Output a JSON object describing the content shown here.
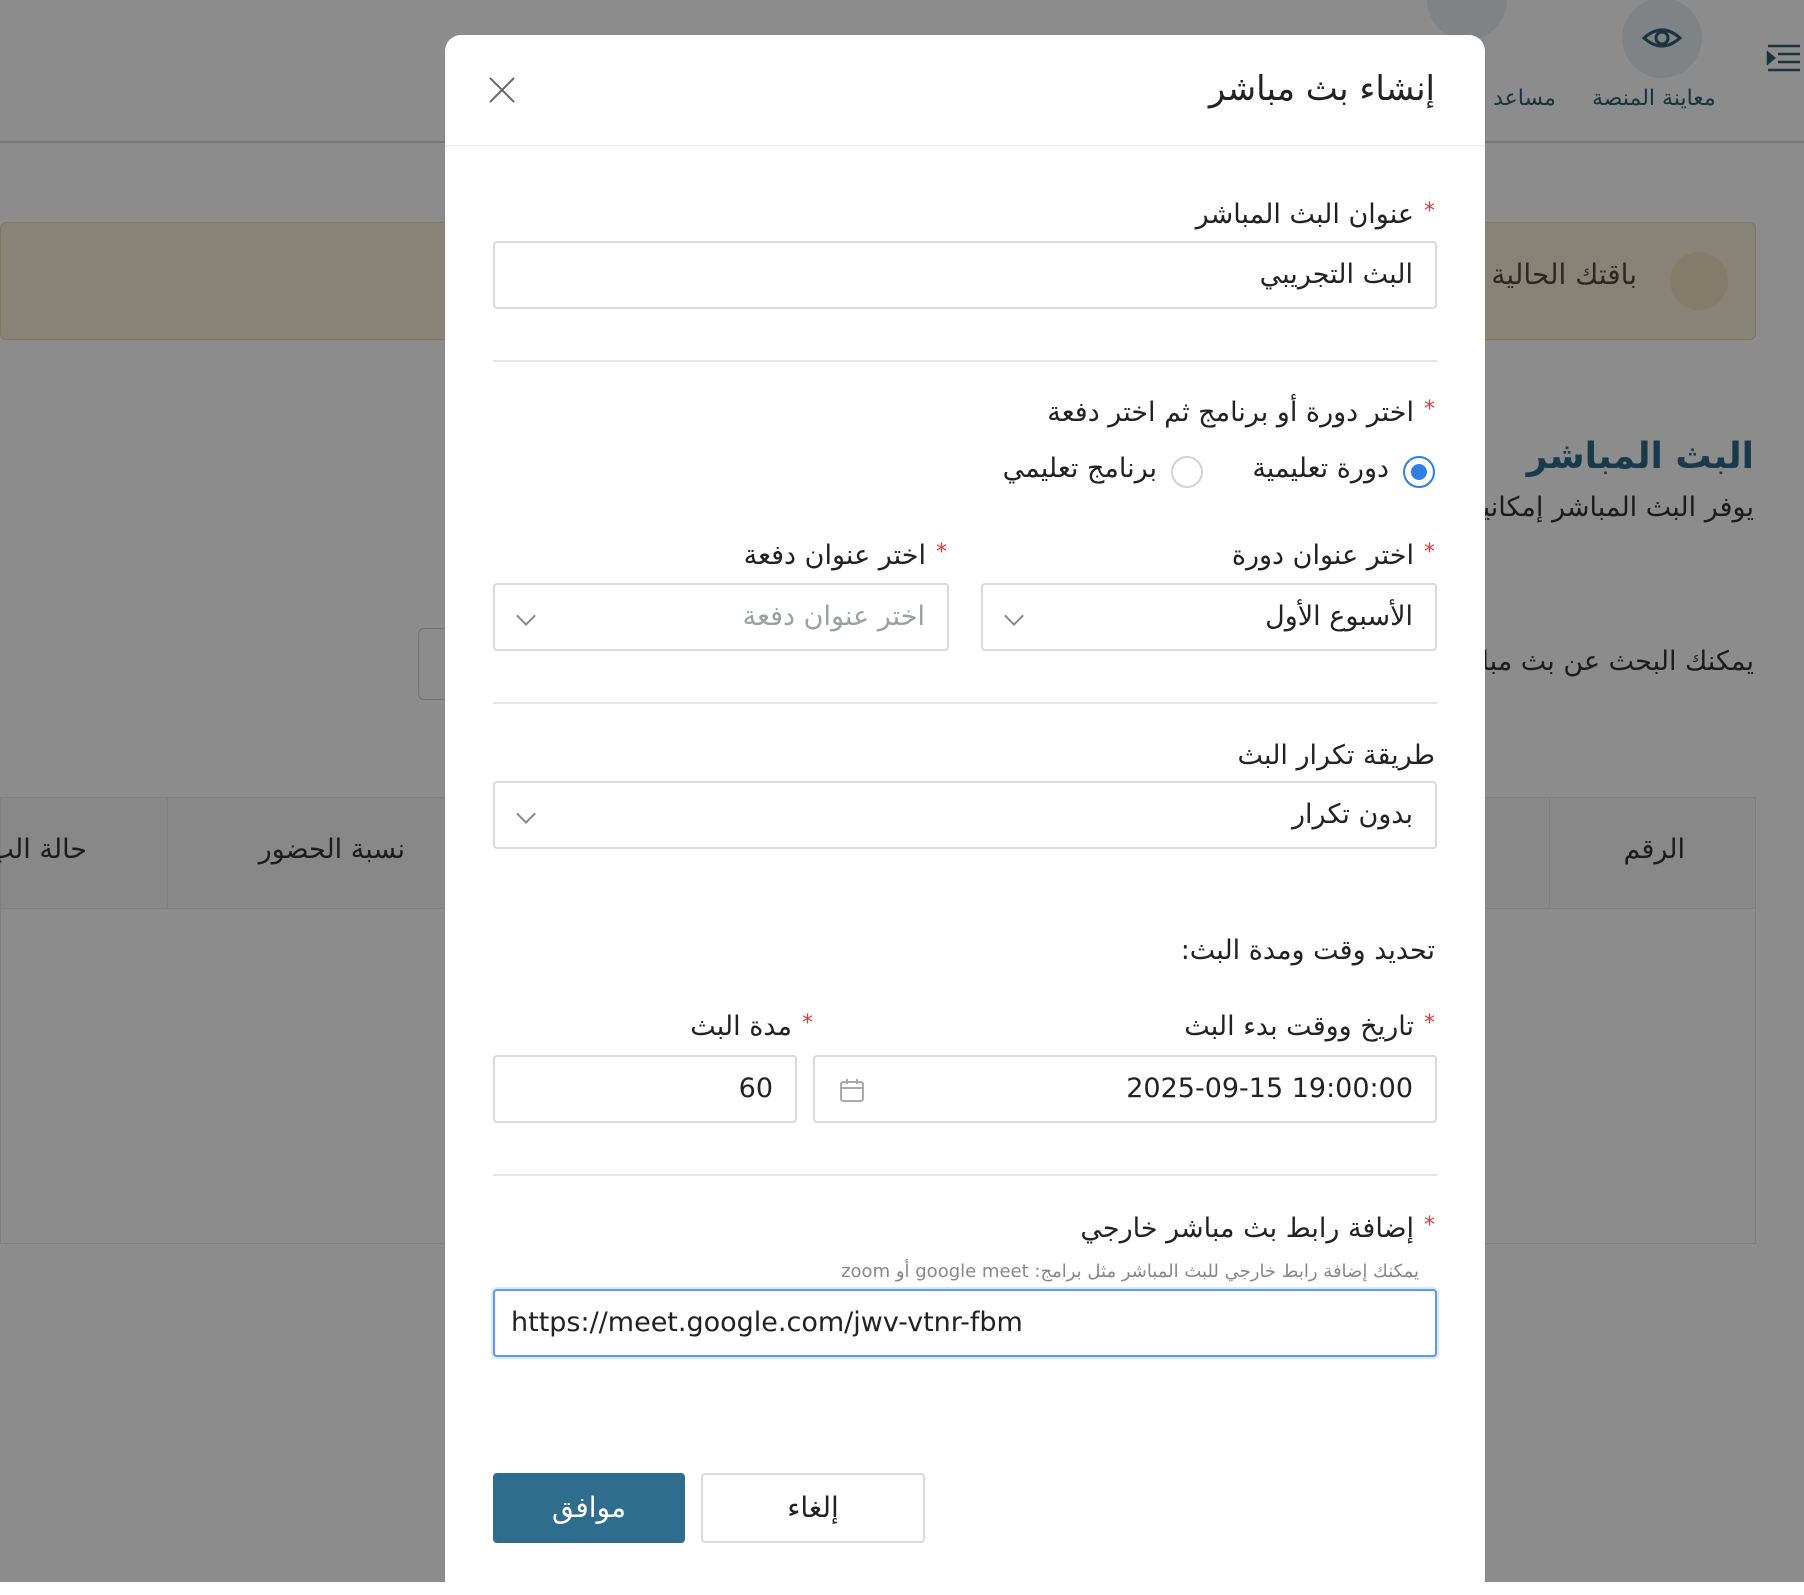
{
  "topbar": {
    "preview_label": "معاينة المنصة",
    "assistant_label": "مساعد إ"
  },
  "banner": {
    "text": "باقتك الحالية"
  },
  "page": {
    "title": "البث المباشر",
    "description": "يوفر البث المباشر إمكانية",
    "search_hint": "يمكنك البحث عن بث مباش"
  },
  "table": {
    "headers": [
      "الرقم",
      "نسبة الحضور",
      "حالة الب"
    ]
  },
  "modal": {
    "title": "إنشاء بث مباشر",
    "stream_title": {
      "label": "عنوان البث المباشر",
      "value": "البث التجريبي"
    },
    "type_select": {
      "label": "اختر دورة أو برنامج ثم اختر دفعة",
      "options": [
        "دورة تعليمية",
        "برنامج تعليمي"
      ],
      "selected": "دورة تعليمية"
    },
    "course": {
      "label": "اختر عنوان دورة",
      "value": "الأسبوع الأول"
    },
    "batch": {
      "label": "اختر عنوان دفعة",
      "placeholder": "اختر عنوان دفعة"
    },
    "repeat": {
      "label": "طريقة تكرار البث",
      "value": "بدون تكرار"
    },
    "schedule_heading": "تحديد وقت ومدة البث:",
    "start": {
      "label": "تاريخ ووقت بدء البث",
      "value": "2025-09-15 19:00:00"
    },
    "duration": {
      "label": "مدة البث",
      "value": "60"
    },
    "link": {
      "label": "إضافة رابط بث مباشر خارجي",
      "hint": "يمكنك إضافة رابط خارجي للبث المباشر مثل برامج: google meet أو zoom",
      "value": "https://meet.google.com/jwv-vtnr-fbm"
    },
    "ok_label": "موافق",
    "cancel_label": "إلغاء"
  },
  "colors": {
    "primary": "#2e6d8e",
    "radio_active": "#2f7fe3",
    "required": "#e03b3b"
  }
}
